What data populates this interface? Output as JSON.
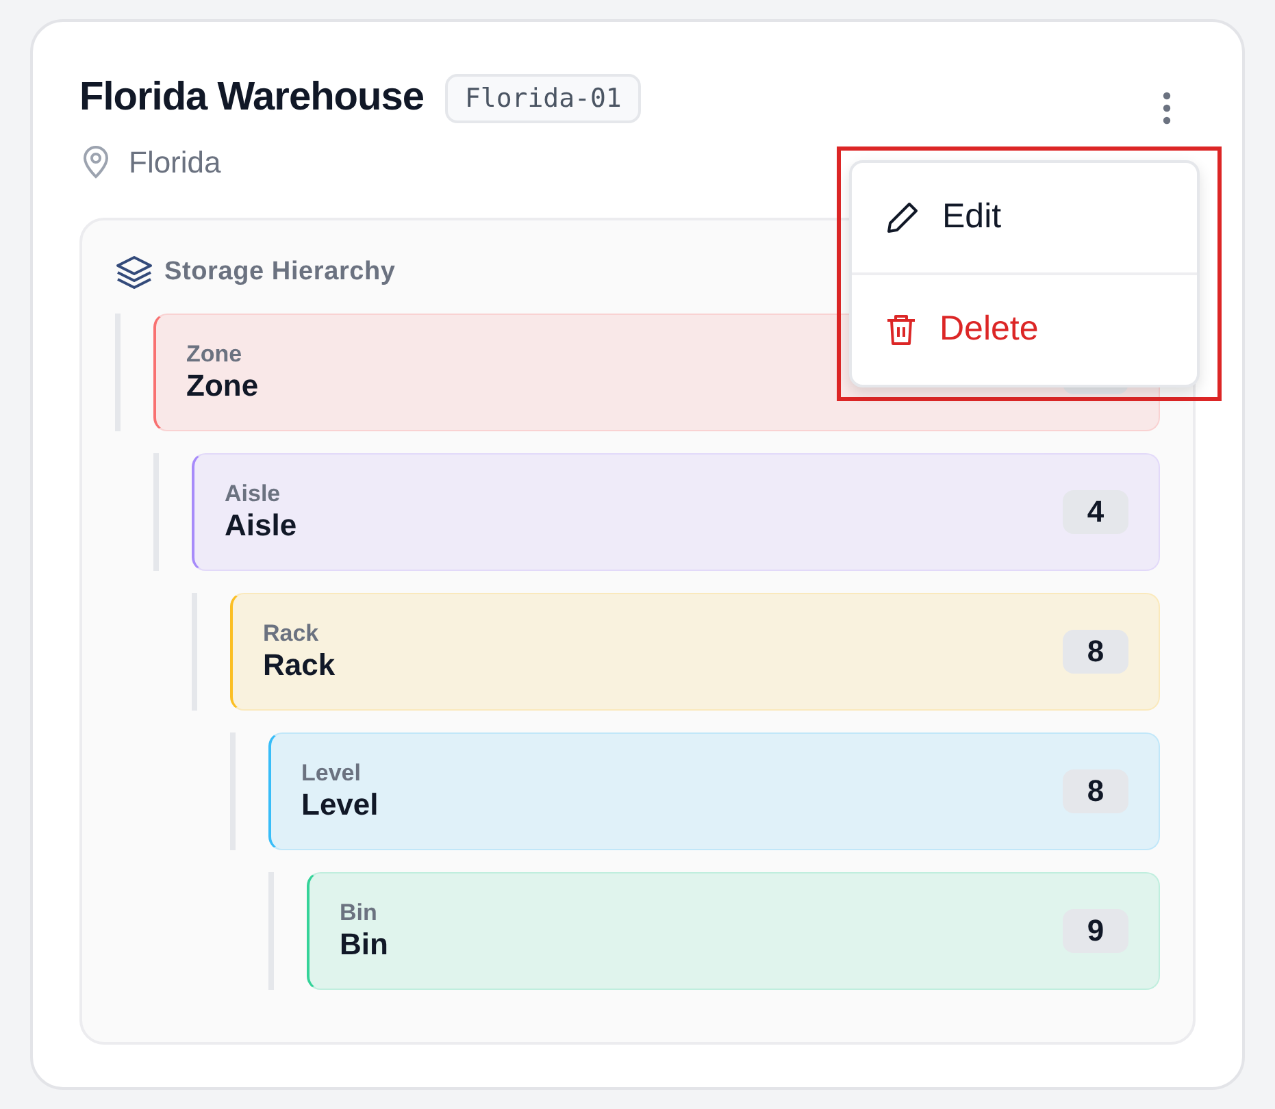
{
  "warehouse": {
    "name": "Florida Warehouse",
    "code": "Florida-01",
    "location": "Florida"
  },
  "hierarchy": {
    "title": "Storage Hierarchy",
    "levels": [
      {
        "type": "Zone",
        "name": "Zone",
        "color": "#f87171",
        "children": [
          {
            "type": "Aisle",
            "name": "Aisle",
            "count": "4",
            "color": "#a78bfa",
            "children": [
              {
                "type": "Rack",
                "name": "Rack",
                "count": "8",
                "color": "#fbbf24",
                "children": [
                  {
                    "type": "Level",
                    "name": "Level",
                    "count": "8",
                    "color": "#38bdf8",
                    "children": [
                      {
                        "type": "Bin",
                        "name": "Bin",
                        "count": "9",
                        "color": "#34d399"
                      }
                    ]
                  }
                ]
              }
            ]
          }
        ]
      }
    ]
  },
  "menu": {
    "items": [
      {
        "kind": "edit",
        "label": "Edit"
      },
      {
        "kind": "delete",
        "label": "Delete"
      }
    ]
  }
}
